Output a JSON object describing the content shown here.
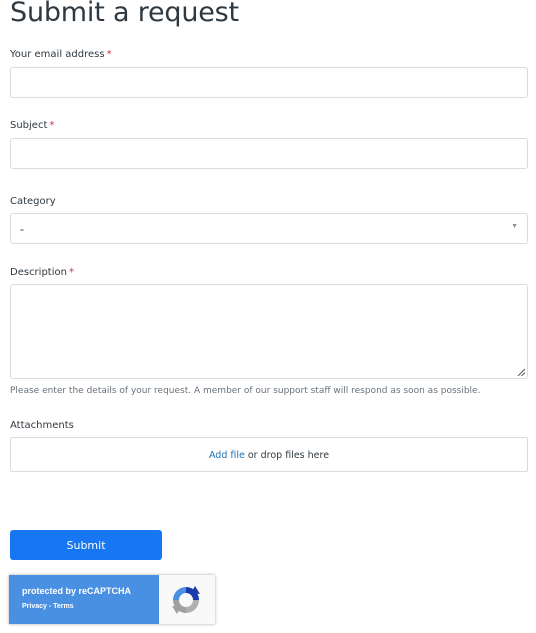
{
  "page": {
    "title": "Submit a request"
  },
  "form": {
    "email": {
      "label": "Your email address",
      "required": "*",
      "value": ""
    },
    "subject": {
      "label": "Subject",
      "required": "*",
      "value": ""
    },
    "category": {
      "label": "Category",
      "selected": "-",
      "caret_icon": "caret-down-icon"
    },
    "description": {
      "label": "Description",
      "required": "*",
      "value": "",
      "hint": "Please enter the details of your request. A member of our support staff will respond as soon as possible."
    },
    "attachments": {
      "label": "Attachments",
      "add_link": "Add file",
      "drop_text": " or drop files here"
    },
    "submit_label": "Submit"
  },
  "recaptcha": {
    "protected_text": "protected by reCAPTCHA",
    "privacy": "Privacy",
    "separator": " - ",
    "terms": "Terms",
    "icon": "recaptcha-logo-icon",
    "colors": {
      "panel": "#4a90e2"
    }
  },
  "colors": {
    "required": "#cc3340",
    "submit": "#1777f2",
    "link": "#1f73b7",
    "border": "#d8dcde"
  }
}
